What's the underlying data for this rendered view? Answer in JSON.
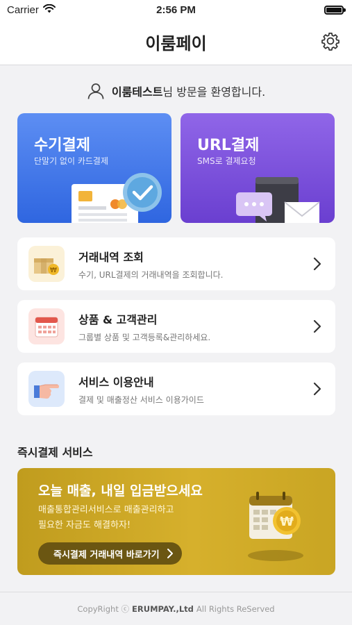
{
  "status_bar": {
    "carrier": "Carrier",
    "time": "2:56 PM",
    "battery_level": 1.0
  },
  "header": {
    "title": "이룸페이",
    "settings_icon": "gear-icon"
  },
  "welcome": {
    "user_name": "이룸테스트",
    "suffix": "님 방문을 환영합니다.",
    "icon": "user-icon"
  },
  "payments": [
    {
      "title": "수기결제",
      "subtitle": "단말기 없이 카드결제",
      "color": "#3c74e8"
    },
    {
      "title": "URL결제",
      "subtitle": "SMS로 결제요청",
      "color": "#7b50dc"
    }
  ],
  "menu": [
    {
      "title": "거래내역 조회",
      "desc": "수기, URL결제의 거래내역을 조회합니다.",
      "icon": "box-coin-icon"
    },
    {
      "title": "상품 & 고객관리",
      "desc": "그룹별 상품 및 고객등록&관리하세요.",
      "icon": "calendar-icon"
    },
    {
      "title": "서비스 이용안내",
      "desc": "결제 및 매출정산 서비스 이용가이드",
      "icon": "pointing-hand-icon"
    }
  ],
  "instant_section": {
    "title": "즉시결제 서비스",
    "promo_title": "오늘 매출, 내일 입금받으세요",
    "promo_line1": "매출통합관리서비스로 매출관리하고",
    "promo_line2": "필요한 자금도 해결하자!",
    "button_label": "즉시결제 거래내역 바로가기",
    "color": "#c9a523"
  },
  "footer": {
    "prefix": "CopyRight ⓒ",
    "brand": "ERUMPAY.,Ltd",
    "suffix": "All Rights ReServed"
  }
}
